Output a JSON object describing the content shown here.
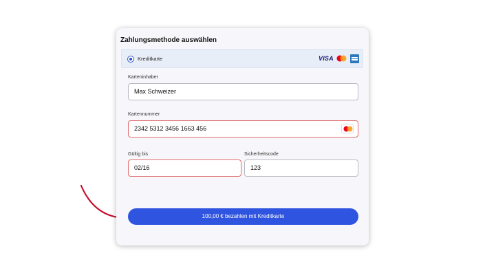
{
  "payment": {
    "title": "Zahlungsmethode auswählen",
    "method": {
      "label": "Kreditkarte",
      "selected": true,
      "logos": [
        "VISA",
        "mastercard-icon",
        "amex-icon"
      ],
      "visa_text": "VISA"
    },
    "fields": {
      "cardholder": {
        "label": "Karteninhaber",
        "value": "Max Schweizer"
      },
      "card_number": {
        "label": "Kartennummer",
        "value": "2342 5312 3456 1663 456",
        "brand_icon": "mastercard-icon"
      },
      "expiry": {
        "label": "Gültig bis",
        "value": "02/16"
      },
      "cvc": {
        "label": "Sicherheitscode",
        "value": "123"
      }
    },
    "pay_button": "100,00 € bezahlen mit Kreditkarte"
  },
  "colors": {
    "accent": "#2f54e0",
    "error_border": "#e06b6b",
    "annotation_arrow": "#c8102e"
  }
}
